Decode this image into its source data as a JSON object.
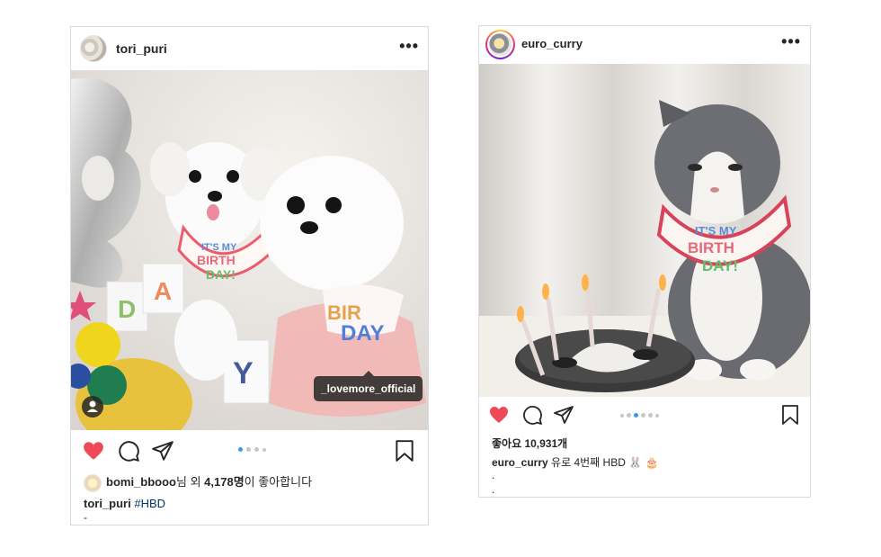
{
  "posts": [
    {
      "username": "tori_puri",
      "more_label": "•••",
      "photo_tag": "_lovemore_official",
      "carousel": {
        "count": 4,
        "active_index": 0
      },
      "likes": {
        "liker": "bomi_bbooo",
        "connector": "님 외 ",
        "count": "4,178명",
        "suffix": "이 좋아합니다"
      },
      "caption": {
        "username": "tori_puri",
        "hashtag": "#HBD"
      },
      "extra_lines": [
        "-"
      ]
    },
    {
      "username": "euro_curry",
      "more_label": "•••",
      "carousel": {
        "count": 6,
        "active_index": 2
      },
      "likes": {
        "label": "좋아요 10,931개"
      },
      "caption": {
        "username": "euro_curry",
        "text": "유로 4번째 HBD 🐰 🎂"
      },
      "extra_lines": [
        ".",
        "."
      ]
    }
  ],
  "colors": {
    "heart": "#ed4956",
    "dot_active": "#3897f0",
    "dot_inactive": "#c7c7c7",
    "hashtag": "#003569"
  },
  "icons": [
    "heart-icon",
    "comment-icon",
    "share-icon",
    "bookmark-icon",
    "more-icon",
    "user-tag-icon"
  ]
}
